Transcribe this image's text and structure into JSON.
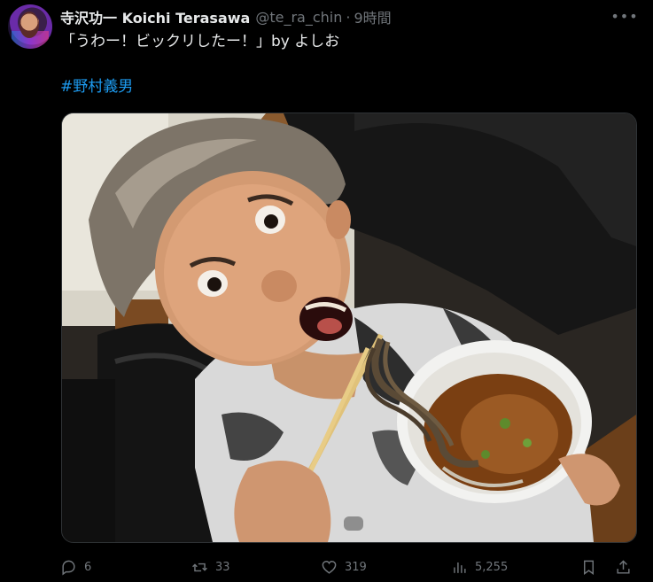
{
  "author": {
    "display_name": "寺沢功一 Koichi Terasawa",
    "handle": "@te_ra_chin",
    "separator": "·",
    "time": "9時間"
  },
  "tweet": {
    "text": "「うわー！ビックリしたー！」by よしお",
    "hashtag": "#野村義男"
  },
  "media": {
    "type": "photo",
    "icon": "photo"
  },
  "actions": {
    "reply_count": "6",
    "retweet_count": "33",
    "like_count": "319",
    "views_count": "5,255"
  },
  "icons": {
    "more": "more-horizontal-icon",
    "reply": "reply-icon",
    "retweet": "retweet-icon",
    "like": "heart-icon",
    "views": "bar-chart-icon",
    "bookmark": "bookmark-icon",
    "share": "share-icon"
  },
  "colors": {
    "background": "#000000",
    "text": "#e7e9ea",
    "muted": "#71767b",
    "link": "#1d9bf0"
  }
}
